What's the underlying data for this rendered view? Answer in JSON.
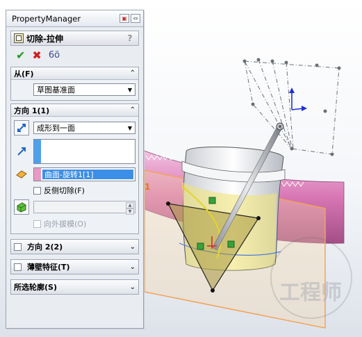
{
  "property_manager": {
    "header": "PropertyManager",
    "feature_title": "切除-拉伸",
    "help_label": "?"
  },
  "actions": {
    "ok": "✔",
    "cancel": "✖",
    "preview": "6ö"
  },
  "from": {
    "title": "从(F)",
    "end_condition": "草图基准面"
  },
  "direction1": {
    "title": "方向 1(1)",
    "end_condition": "成形到一面",
    "face_selection": "曲面-旋转1[1]",
    "flip_side_label": "反侧切除(F)",
    "draft_outward_label": "向外拔模(O)"
  },
  "direction2": {
    "title": "方向 2(2)"
  },
  "thin_feature": {
    "title": "薄壁特征(T)"
  },
  "selected_contours": {
    "title": "所选轮廓(S)"
  },
  "viewport": {
    "label_mark": "1"
  },
  "colors": {
    "pm_background": "#e9ecf1",
    "selection_blue": "#3c8ee6",
    "surface_pink": "#d877b4",
    "plane_orange": "#f2a35a",
    "sketch_yellow": "#f0e47a"
  },
  "watermark": "工程师"
}
